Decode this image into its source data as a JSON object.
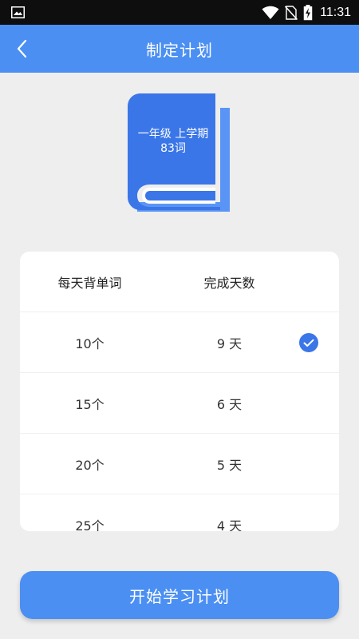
{
  "status_bar": {
    "time": "11:31",
    "icons": [
      "gallery-icon",
      "wifi-icon",
      "no-sim-icon",
      "battery-charging-icon"
    ]
  },
  "app_bar": {
    "title": "制定计划",
    "back_icon": "chevron-left-icon"
  },
  "book": {
    "line1": "一年级 上学期",
    "line2": "83词"
  },
  "plan_table": {
    "headers": {
      "words_per_day": "每天背单词",
      "days_to_complete": "完成天数"
    },
    "rows": [
      {
        "words": "10个",
        "days": "9 天",
        "selected": true
      },
      {
        "words": "15个",
        "days": "6 天",
        "selected": false
      },
      {
        "words": "20个",
        "days": "5 天",
        "selected": false
      },
      {
        "words": "25个",
        "days": "4 天",
        "selected": false
      }
    ]
  },
  "start_button": {
    "label": "开始学习计划"
  },
  "colors": {
    "primary": "#4b8ff2",
    "check": "#3a76e8",
    "background": "#eeeeee",
    "book_dark": "#3a76e8",
    "book_light": "#5a95f5"
  }
}
